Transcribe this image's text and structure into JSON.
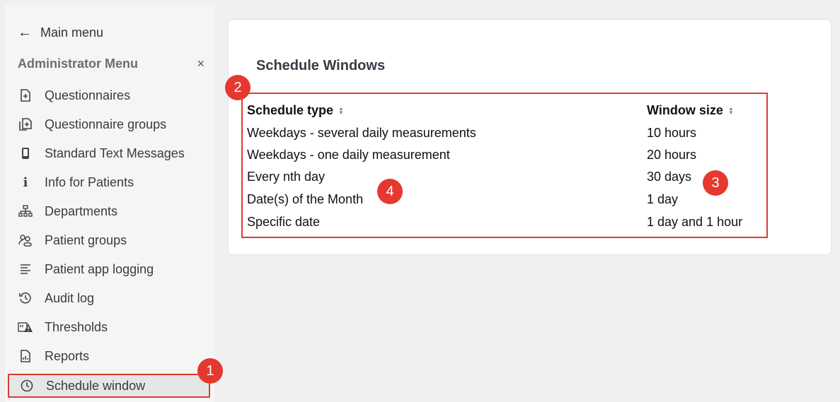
{
  "sidebar": {
    "back_label": "Main menu",
    "menu_title": "Administrator Menu",
    "close_symbol": "×",
    "items": [
      {
        "label": "Questionnaires",
        "icon": "file-plus-icon"
      },
      {
        "label": "Questionnaire groups",
        "icon": "files-plus-icon"
      },
      {
        "label": "Standard Text Messages",
        "icon": "phone-icon"
      },
      {
        "label": "Info for Patients",
        "icon": "info-icon"
      },
      {
        "label": "Departments",
        "icon": "org-chart-icon"
      },
      {
        "label": "Patient groups",
        "icon": "users-icon"
      },
      {
        "label": "Patient app logging",
        "icon": "list-icon"
      },
      {
        "label": "Audit log",
        "icon": "history-icon"
      },
      {
        "label": "Thresholds",
        "icon": "threshold-warning-icon"
      },
      {
        "label": "Reports",
        "icon": "report-icon"
      },
      {
        "label": "Schedule window",
        "icon": "clock-icon",
        "active": true
      }
    ]
  },
  "main": {
    "title": "Schedule Windows",
    "table": {
      "headers": [
        "Schedule type",
        "Window size"
      ],
      "rows": [
        [
          "Weekdays - several daily measurements",
          "10 hours"
        ],
        [
          "Weekdays - one daily measurement",
          "20 hours"
        ],
        [
          "Every nth day",
          "30 days"
        ],
        [
          "Date(s) of the Month",
          "1 day"
        ],
        [
          "Specific date",
          "1 day and 1 hour"
        ]
      ]
    }
  },
  "annotations": [
    "1",
    "2",
    "3",
    "4"
  ],
  "colors": {
    "highlight": "#e03a33",
    "badge": "#e5382f",
    "card_bg": "#ffffff",
    "page_bg": "#f0f0f1"
  }
}
